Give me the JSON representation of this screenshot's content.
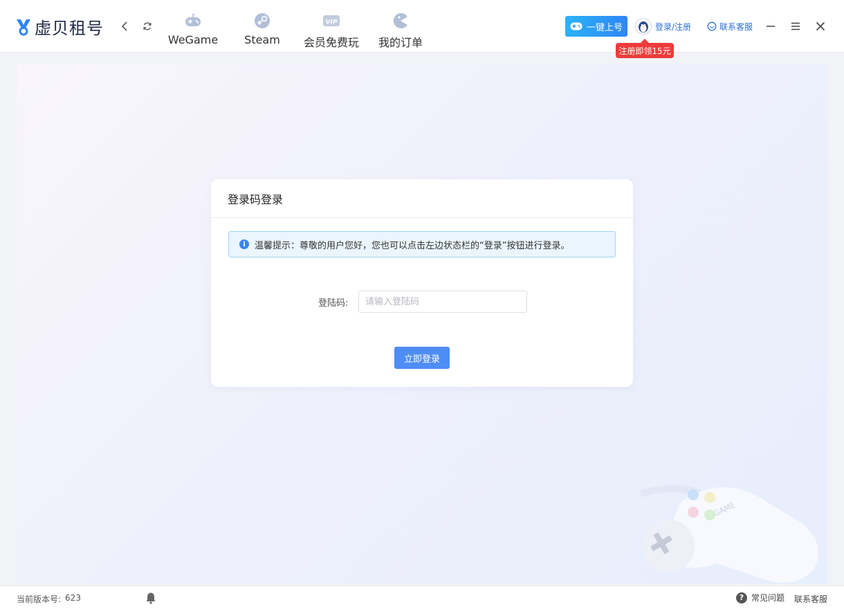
{
  "app": {
    "name": "虚贝租号",
    "brand_color": "#2f86f5"
  },
  "nav": {
    "back_icon": "chevron-left-icon",
    "refresh_icon": "refresh-icon",
    "items": [
      {
        "label": "WeGame",
        "icon": "gamepad-icon"
      },
      {
        "label": "Steam",
        "icon": "steam-icon"
      },
      {
        "label": "会员免费玩",
        "icon": "vip-icon"
      },
      {
        "label": "我的订单",
        "icon": "pacman-icon"
      }
    ]
  },
  "header": {
    "quick_login_label": "一键上号",
    "login_label": "登录/注册",
    "promo_badge": "注册即领15元",
    "service_label": "联系客服"
  },
  "login_card": {
    "title": "登录码登录",
    "tip": "温馨提示：尊敬的用户您好，您也可以点击左边状态栏的“登录”按钮进行登录。",
    "field_label": "登陆码:",
    "field_placeholder": "请输入登陆码",
    "field_value": "",
    "submit_label": "立即登录"
  },
  "statusbar": {
    "version_label": "当前版本号:",
    "version_value": "623",
    "faq_label": "常见问题",
    "service_label": "联系客服"
  }
}
